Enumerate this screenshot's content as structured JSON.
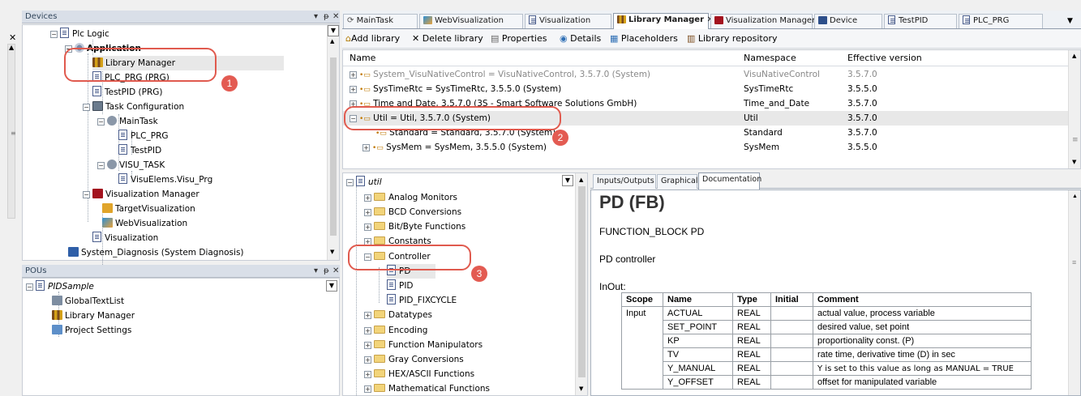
{
  "devices_pane": {
    "title": "Devices",
    "tree": [
      {
        "label": "Plc Logic"
      },
      {
        "label": "Application"
      },
      {
        "label": "Library Manager"
      },
      {
        "label": "PLC_PRG (PRG)"
      },
      {
        "label": "TestPID (PRG)"
      },
      {
        "label": "Task Configuration"
      },
      {
        "label": "MainTask"
      },
      {
        "label": "PLC_PRG"
      },
      {
        "label": "TestPID"
      },
      {
        "label": "VISU_TASK"
      },
      {
        "label": "VisuElems.Visu_Prg"
      },
      {
        "label": "Visualization Manager"
      },
      {
        "label": "TargetVisualization"
      },
      {
        "label": "WebVisualization"
      },
      {
        "label": "Visualization"
      },
      {
        "label": "System_Diagnosis (System Diagnosis)"
      }
    ]
  },
  "pous_pane": {
    "title": "POUs",
    "tree": [
      {
        "label": "PIDSample"
      },
      {
        "label": "GlobalTextList"
      },
      {
        "label": "Library Manager"
      },
      {
        "label": "Project Settings"
      }
    ]
  },
  "editor_tabs": [
    {
      "label": "MainTask"
    },
    {
      "label": "WebVisualization"
    },
    {
      "label": "Visualization"
    },
    {
      "label": "Library Manager"
    },
    {
      "label": "Visualization Manager"
    },
    {
      "label": "Device"
    },
    {
      "label": "TestPID"
    },
    {
      "label": "PLC_PRG"
    }
  ],
  "toolbar": {
    "add": "Add library",
    "delete": "Delete library",
    "properties": "Properties",
    "details": "Details",
    "placeholders": "Placeholders",
    "repository": "Library repository"
  },
  "lib_table": {
    "headers": {
      "name": "Name",
      "namespace": "Namespace",
      "version": "Effective version"
    },
    "rows": [
      {
        "name": "System_VisuNativeControl = VisuNativeControl, 3.5.7.0 (System)",
        "ns": "VisuNativeControl",
        "ver": "3.5.7.0"
      },
      {
        "name": "SysTimeRtc = SysTimeRtc, 3.5.5.0 (System)",
        "ns": "SysTimeRtc",
        "ver": "3.5.5.0"
      },
      {
        "name": "Time and Date, 3.5.7.0 (3S - Smart Software Solutions GmbH)",
        "ns": "Time_and_Date",
        "ver": "3.5.7.0"
      },
      {
        "name": "Util = Util, 3.5.7.0 (System)",
        "ns": "Util",
        "ver": "3.5.7.0"
      },
      {
        "name": "Standard = Standard, 3.5.7.0 (System)",
        "ns": "Standard",
        "ver": "3.5.7.0"
      },
      {
        "name": "SysMem = SysMem, 3.5.5.0 (System)",
        "ns": "SysMem",
        "ver": "3.5.5.0"
      }
    ]
  },
  "util_tree": {
    "root": "util",
    "items": [
      {
        "label": "Analog Monitors"
      },
      {
        "label": "BCD Conversions"
      },
      {
        "label": "Bit/Byte Functions"
      },
      {
        "label": "Constants"
      },
      {
        "label": "Controller"
      },
      {
        "label": "PD"
      },
      {
        "label": "PID"
      },
      {
        "label": "PID_FIXCYCLE"
      },
      {
        "label": "Datatypes"
      },
      {
        "label": "Encoding"
      },
      {
        "label": "Function Manipulators"
      },
      {
        "label": "Gray Conversions"
      },
      {
        "label": "HEX/ASCII Functions"
      },
      {
        "label": "Mathematical Functions"
      }
    ]
  },
  "doc_tabs": [
    "Inputs/Outputs",
    "Graphical",
    "Documentation"
  ],
  "documentation": {
    "title": "PD (FB)",
    "decl": "FUNCTION_BLOCK PD",
    "desc": "PD controller",
    "section": "InOut:",
    "headers": [
      "Scope",
      "Name",
      "Type",
      "Initial",
      "Comment"
    ],
    "rows": [
      {
        "scope": "Input",
        "name": "ACTUAL",
        "type": "REAL",
        "initial": "",
        "comment": "actual value, process variable"
      },
      {
        "scope": "",
        "name": "SET_POINT",
        "type": "REAL",
        "initial": "",
        "comment": "desired value, set point"
      },
      {
        "scope": "",
        "name": "KP",
        "type": "REAL",
        "initial": "",
        "comment": "proportionality const. (P)"
      },
      {
        "scope": "",
        "name": "TV",
        "type": "REAL",
        "initial": "",
        "comment": "rate time, derivative time (D) in sec"
      },
      {
        "scope": "",
        "name": "Y_MANUAL",
        "type": "REAL",
        "initial": "",
        "comment": "Y is set to this value as long as MANUAL = TRUE"
      },
      {
        "scope": "",
        "name": "Y_OFFSET",
        "type": "REAL",
        "initial": "",
        "comment": "offset for manipulated variable"
      }
    ]
  },
  "badges": [
    "1",
    "2",
    "3"
  ],
  "colors": {
    "annotation": "#e05a4e",
    "title_bar": "#d9dfe8",
    "selected_row": "#e8e8e8"
  }
}
